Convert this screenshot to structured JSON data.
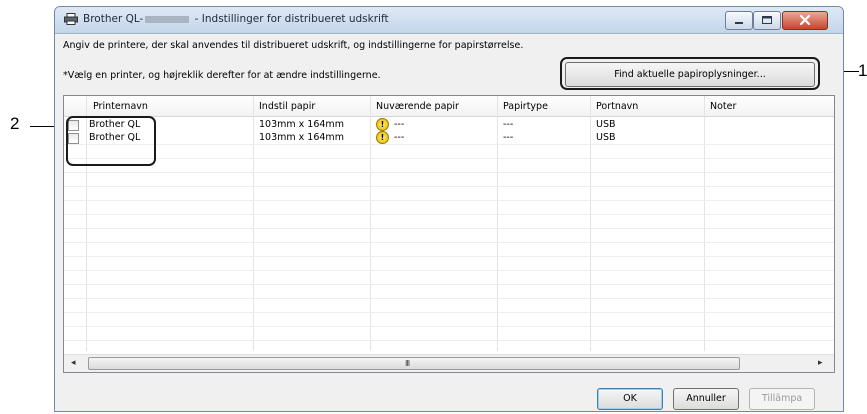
{
  "callouts": {
    "label_1": "1",
    "label_2": "2"
  },
  "window": {
    "title_prefix": "Brother QL-",
    "title_suffix": "- Indstillinger for distribueret udskrift",
    "icon": "printer-icon"
  },
  "description": "Angiv de printere, der skal anvendes til distribueret udskrift, og indstillingerne for papirstørrelse.",
  "hint": "*Vælg en printer, og højreklik derefter for at ændre indstillingerne.",
  "find_button": {
    "label": "Find aktuelle papiroplysninger...",
    "mnemonic": "F"
  },
  "table": {
    "columns": [
      "Printernavn",
      "Indstil papir",
      "Nuværende papir",
      "Papirtype",
      "Portnavn",
      "Noter"
    ],
    "rows": [
      {
        "name": "Brother QL",
        "paper_setting": "103mm x 164mm",
        "current_paper": "---",
        "paper_type": "---",
        "port": "USB",
        "notes": ""
      },
      {
        "name": "Brother QL",
        "paper_setting": "103mm x 164mm",
        "current_paper": "---",
        "paper_type": "---",
        "port": "USB",
        "notes": ""
      }
    ]
  },
  "scrollbar": {
    "grip": "III"
  },
  "buttons": {
    "ok": "OK",
    "cancel": "Annuller",
    "apply": "Tillämpa"
  },
  "colors": {
    "title_bar": "#c3d5ea",
    "close_button": "#c7452d",
    "warning": "#e3b000"
  }
}
